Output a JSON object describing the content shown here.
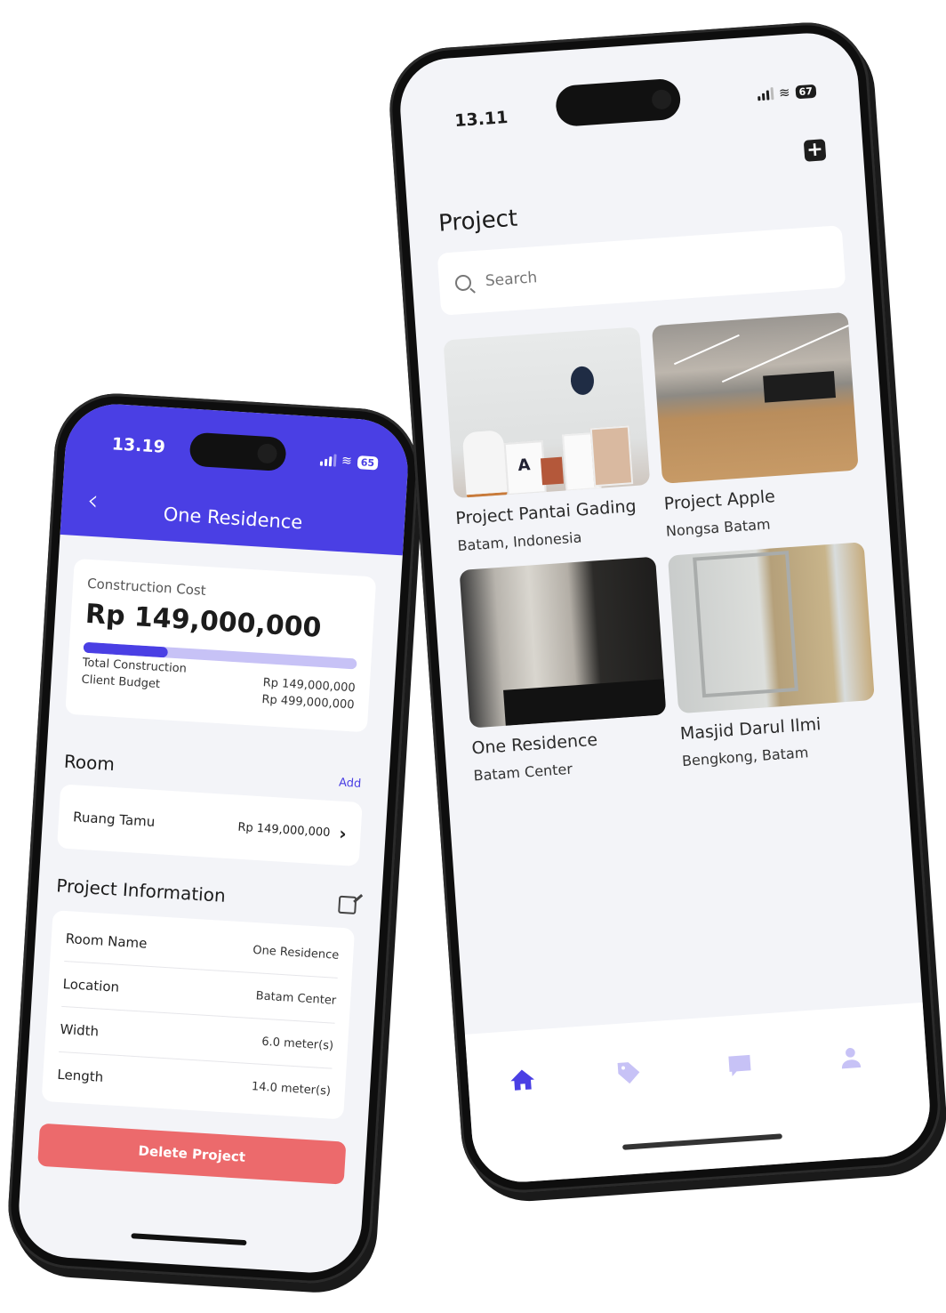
{
  "left_phone": {
    "status": {
      "time": "13.19",
      "battery": "65"
    },
    "header": {
      "back_label": "‹",
      "title": "One Residence"
    },
    "construction_card": {
      "label": "Construction Cost",
      "value": "Rp 149,000,000",
      "progress_fraction": 0.31,
      "rows": [
        {
          "label": "Total Construction",
          "value": "Rp 149,000,000"
        },
        {
          "label": "Client Budget",
          "value": "Rp 499,000,000"
        }
      ]
    },
    "room_section": {
      "title": "Room",
      "add_label": "Add",
      "items": [
        {
          "name": "Ruang Tamu",
          "value": "Rp 149,000,000"
        }
      ]
    },
    "info_section": {
      "title": "Project Information",
      "rows": [
        {
          "label": "Room Name",
          "value": "One Residence"
        },
        {
          "label": "Location",
          "value": "Batam Center"
        },
        {
          "label": "Width",
          "value": "6.0 meter(s)"
        },
        {
          "label": "Length",
          "value": "14.0 meter(s)"
        }
      ]
    },
    "delete_label": "Delete Project"
  },
  "right_phone": {
    "status": {
      "time": "13.11",
      "battery": "67"
    },
    "title": "Project",
    "add_label": "+",
    "search": {
      "placeholder": "Search",
      "value": ""
    },
    "projects": [
      {
        "name": "Project Pantai Gading",
        "location": "Batam, Indonesia"
      },
      {
        "name": "Project Apple",
        "location": "Nongsa Batam"
      },
      {
        "name": "One Residence",
        "location": "Batam Center"
      },
      {
        "name": "Masjid Darul Ilmi",
        "location": "Bengkong, Batam"
      }
    ],
    "tabs": [
      {
        "name": "home",
        "active": true
      },
      {
        "name": "tag",
        "active": false
      },
      {
        "name": "chat",
        "active": false
      },
      {
        "name": "profile",
        "active": false
      }
    ]
  },
  "colors": {
    "accent": "#4a3fe4",
    "accent_light": "#c7c2f6",
    "danger": "#ec6a6c",
    "background": "#f3f4f8"
  }
}
